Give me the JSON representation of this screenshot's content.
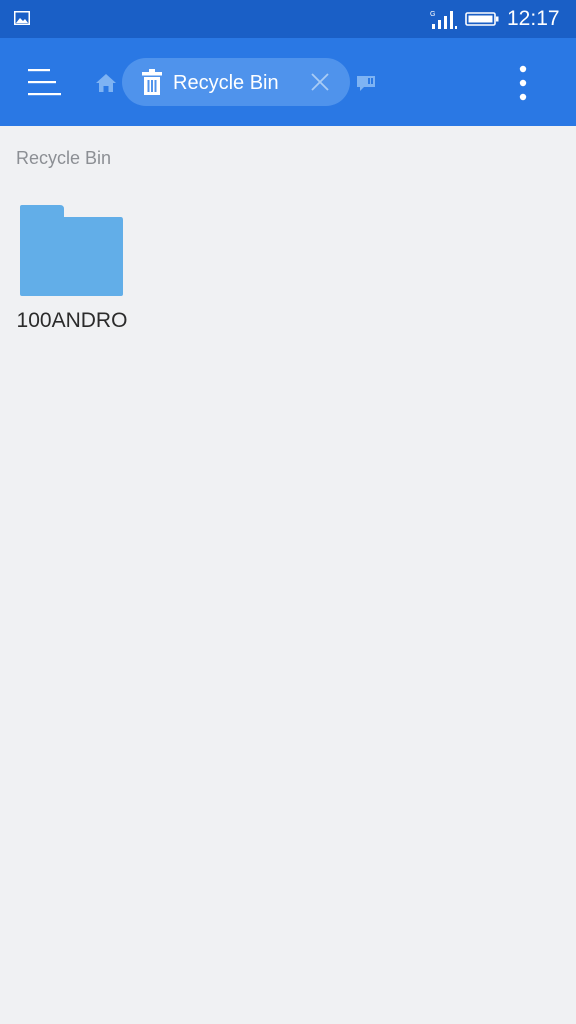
{
  "status_bar": {
    "time": "12:17",
    "network_type": "G",
    "icons": [
      "gallery-icon",
      "signal-icon",
      "battery-icon"
    ]
  },
  "app_bar": {
    "active_tab": {
      "label": "Recycle Bin",
      "icon": "trash-icon"
    },
    "icons": [
      "menu-icon",
      "home-icon",
      "close-icon",
      "storage-icon",
      "more-icon"
    ],
    "colors": {
      "status_bar": "#1a5fc6",
      "app_bar": "#2a78e4",
      "tab_chip": "#4f93ec"
    }
  },
  "content": {
    "path_label": "Recycle Bin",
    "items": [
      {
        "name": "100ANDRO",
        "type": "folder",
        "icon": "folder-icon",
        "color": "#62aee8"
      }
    ]
  }
}
